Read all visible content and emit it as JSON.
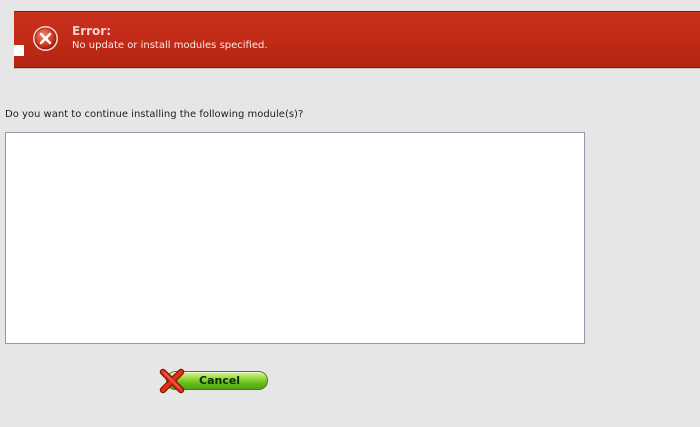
{
  "error": {
    "title": "Error:",
    "message": "No update or install modules specified.",
    "icon": "error-x-circle-icon",
    "color": "#c12a16"
  },
  "prompt": {
    "text": "Do you want to continue installing the following module(s)?"
  },
  "module_list": {
    "items": []
  },
  "cancel_button": {
    "label": "Cancel",
    "icon": "red-x-icon",
    "color": "#6cc21e"
  }
}
